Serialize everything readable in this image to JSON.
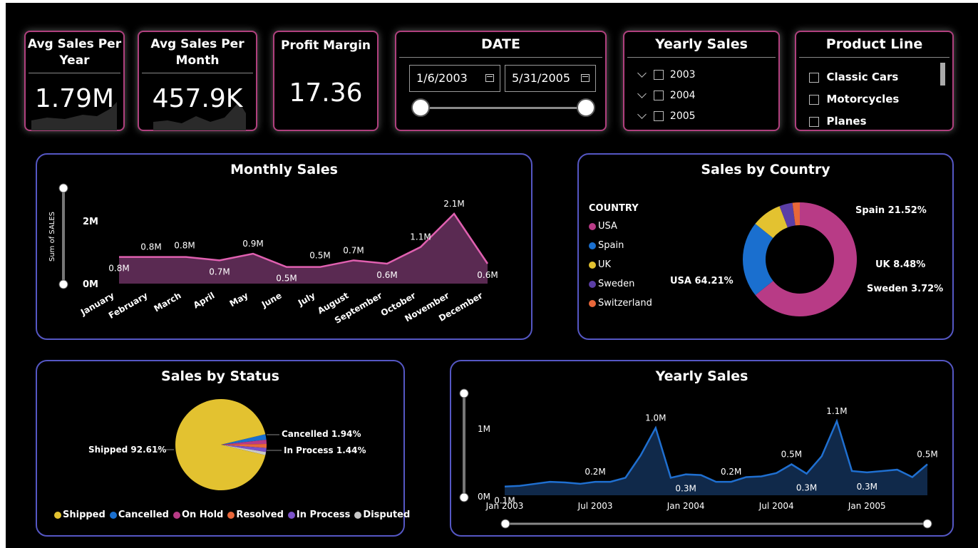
{
  "kpis": {
    "avg_year": {
      "title_l1": "Avg Sales Per",
      "title_l2": "Year",
      "value": "1.79M"
    },
    "avg_month": {
      "title_l1": "Avg Sales Per",
      "title_l2": "Month",
      "value": "457.9K"
    },
    "profit": {
      "title": "Profit Margin",
      "value": "17.36"
    }
  },
  "date_slicer": {
    "title": "DATE",
    "start": "1/6/2003",
    "end": "5/31/2005"
  },
  "yearly_slicer": {
    "title": "Yearly Sales",
    "items": [
      "2003",
      "2004",
      "2005"
    ]
  },
  "product_slicer": {
    "title": "Product Line",
    "items": [
      "Classic Cars",
      "Motorcycles",
      "Planes"
    ]
  },
  "monthly": {
    "title": "Monthly Sales",
    "ylabel": "Sum of SALES",
    "yticks": [
      "2M",
      "0M"
    ],
    "chart_data": {
      "type": "area",
      "categories": [
        "January",
        "February",
        "March",
        "April",
        "May",
        "June",
        "July",
        "August",
        "September",
        "October",
        "November",
        "December"
      ],
      "values": [
        0.8,
        0.8,
        0.8,
        0.7,
        0.9,
        0.5,
        0.5,
        0.7,
        0.6,
        1.1,
        2.1,
        0.6
      ],
      "labels": [
        "0.8M",
        "0.8M",
        "0.8M",
        "0.7M",
        "0.9M",
        "0.5M",
        "0.5M",
        "0.7M",
        "0.6M",
        "1.1M",
        "2.1M",
        "0.6M"
      ],
      "ylim": [
        0,
        2.1
      ],
      "color": "#e060b0"
    }
  },
  "country": {
    "title": "Sales by Country",
    "legend_title": "COUNTRY",
    "chart_data": {
      "type": "pie",
      "categories": [
        "USA",
        "Spain",
        "UK",
        "Sweden",
        "Switzerland"
      ],
      "values": [
        64.21,
        21.52,
        8.48,
        3.72,
        2.07
      ],
      "labels": [
        "USA 64.21%",
        "Spain 21.52%",
        "UK 8.48%",
        "Sweden 3.72%",
        ""
      ],
      "colors": [
        "#b83b86",
        "#1a6fcf",
        "#e3c230",
        "#5b3ea6",
        "#e8673a"
      ]
    }
  },
  "status": {
    "title": "Sales by Status",
    "chart_data": {
      "type": "pie",
      "categories": [
        "Shipped",
        "Cancelled",
        "On Hold",
        "Resolved",
        "In Process",
        "Disputed"
      ],
      "values": [
        92.61,
        1.94,
        1.5,
        1.4,
        1.44,
        1.11
      ],
      "labels": [
        "Shipped 92.61%",
        "Cancelled 1.94%",
        "",
        "",
        "In Process 1.44%",
        ""
      ],
      "colors": [
        "#e3c230",
        "#1a6fcf",
        "#b83b86",
        "#e8673a",
        "#7b52c9",
        "#c8c8c8"
      ]
    }
  },
  "yearly": {
    "title": "Yearly Sales",
    "yticks": [
      "1M",
      "0M"
    ],
    "xticks": [
      "Jan 2003",
      "Jul 2003",
      "Jan 2004",
      "Jul 2004",
      "Jan 2005"
    ],
    "chart_data": {
      "type": "area",
      "x": [
        "2003-01",
        "2003-02",
        "2003-03",
        "2003-04",
        "2003-05",
        "2003-06",
        "2003-07",
        "2003-08",
        "2003-09",
        "2003-10",
        "2003-11",
        "2003-12",
        "2004-01",
        "2004-02",
        "2004-03",
        "2004-04",
        "2004-05",
        "2004-06",
        "2004-07",
        "2004-08",
        "2004-09",
        "2004-10",
        "2004-11",
        "2004-12",
        "2005-01",
        "2005-02",
        "2005-03",
        "2005-04",
        "2005-05"
      ],
      "values": [
        0.13,
        0.14,
        0.17,
        0.2,
        0.19,
        0.17,
        0.2,
        0.2,
        0.26,
        0.59,
        1.0,
        0.26,
        0.31,
        0.3,
        0.2,
        0.2,
        0.27,
        0.28,
        0.33,
        0.46,
        0.32,
        0.58,
        1.1,
        0.36,
        0.34,
        0.36,
        0.38,
        0.27,
        0.46
      ],
      "labels": [
        {
          "i": 0,
          "text": "0.1M"
        },
        {
          "i": 6,
          "text": "0.2M"
        },
        {
          "i": 10,
          "text": "1.0M"
        },
        {
          "i": 12,
          "text": "0.3M"
        },
        {
          "i": 15,
          "text": "0.2M"
        },
        {
          "i": 19,
          "text": "0.5M"
        },
        {
          "i": 20,
          "text": "0.3M"
        },
        {
          "i": 22,
          "text": "1.1M"
        },
        {
          "i": 24,
          "text": "0.3M"
        },
        {
          "i": 28,
          "text": "0.5M"
        }
      ],
      "ylim": [
        0,
        1.1
      ],
      "color": "#1f6fd0"
    }
  }
}
